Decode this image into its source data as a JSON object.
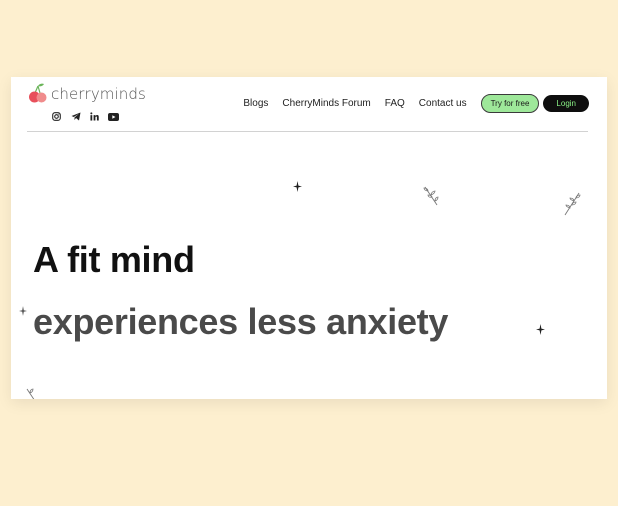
{
  "brand": {
    "name": "cherryminds"
  },
  "socials": [
    {
      "icon": "instagram-icon"
    },
    {
      "icon": "telegram-icon"
    },
    {
      "icon": "linkedin-icon"
    },
    {
      "icon": "youtube-icon"
    }
  ],
  "nav": {
    "links": [
      "Blogs",
      "CherryMinds Forum",
      "FAQ",
      "Contact us"
    ],
    "try_label": "Try for free",
    "login_label": "Login"
  },
  "hero": {
    "line1": "A fit mind",
    "line2": "experiences less anxiety"
  },
  "colors": {
    "page_background": "#fdefcf",
    "try_button": "#9ee89a",
    "login_button": "#0e0e0e",
    "login_text": "#8af286",
    "cherry": "#e8505b"
  }
}
